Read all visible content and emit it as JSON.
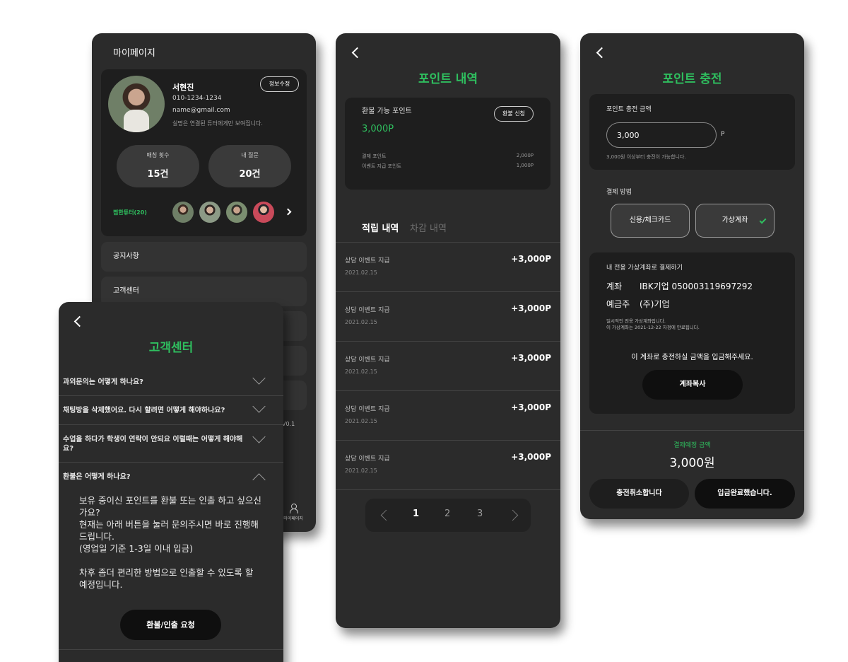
{
  "colors": {
    "accent_green": "#2fbf5f",
    "panel": "#2b2b2b",
    "card": "#1e1e1e"
  },
  "mypage": {
    "title": "마이페이지",
    "profile": {
      "name": "서현진",
      "phone": "010-1234-1234",
      "email": "name@gmail.com",
      "note": "실명은 연결된 튜터에게만 보여집니다.",
      "edit_label": "정보수정"
    },
    "stats": [
      {
        "label": "매칭 횟수",
        "value": "15건"
      },
      {
        "label": "내 질문",
        "value": "20건"
      }
    ],
    "favorites_label": "찜한튜터(20)",
    "menu": [
      "공지사항",
      "고객센터"
    ],
    "version": "V0.1",
    "nav_label": "마이페이지"
  },
  "customer_center": {
    "title": "고객센터",
    "faqs": [
      {
        "question": "과외문의는 어떻게 하나요?",
        "expanded": false
      },
      {
        "question": "채팅방을 삭제했어요. 다시 할려면 어떻게 해야하나요?",
        "expanded": false
      },
      {
        "question": "수업을 하다가 학생이 연락이 안되요 이럴때는 어떻게 해야해요?",
        "expanded": false
      },
      {
        "question": "환불은 어떻게 하나요?",
        "expanded": true
      }
    ],
    "answer": {
      "line1": "보유 중이신 포인트를 환불 또는 인출 하고 싶으신가요?",
      "line2": "현재는 아래 버튼을 눌러 문의주시면 바로 진행해드립니다.",
      "line3": "(영업일 기준 1-3일 이내 입금)",
      "line4": "차후 좀더 편리한 방법으로 인출할 수 있도록 할 예정입니다."
    },
    "refund_button": "환불/인출 요청"
  },
  "points": {
    "title": "포인트 내역",
    "refundable_label": "환불 가능 포인트",
    "refundable_value": "3,000P",
    "refund_button": "환불 신청",
    "breakdown": [
      {
        "label": "결제 포인트",
        "value": "2,000P"
      },
      {
        "label": "이벤트 지급 포인트",
        "value": "1,000P"
      }
    ],
    "tabs": [
      "적립 내역",
      "차감 내역"
    ],
    "history": [
      {
        "title": "상담 이벤트 지급",
        "date": "2021.02.15",
        "amount": "+3,000P"
      },
      {
        "title": "상담 이벤트 지급",
        "date": "2021.02.15",
        "amount": "+3,000P"
      },
      {
        "title": "상담 이벤트 지급",
        "date": "2021.02.15",
        "amount": "+3,000P"
      },
      {
        "title": "상담 이벤트 지급",
        "date": "2021.02.15",
        "amount": "+3,000P"
      },
      {
        "title": "상담 이벤트 지급",
        "date": "2021.02.15",
        "amount": "+3,000P"
      }
    ],
    "pages": [
      "1",
      "2",
      "3"
    ],
    "current_page": "1"
  },
  "charge": {
    "title": "포인트 충전",
    "amount_label": "포인트 충전 금액",
    "amount_value": "3,000",
    "amount_unit": "P",
    "amount_hint": "3,000원 이상부터 충전이 가능합니다.",
    "method_label": "결제 방법",
    "methods": [
      "신용/체크카드",
      "가상계좌"
    ],
    "selected_method": "가상계좌",
    "va_title": "내 전용 가상계좌로 결제하기",
    "account_label": "계좌",
    "account_value": "IBK기업 050003119697292",
    "holder_label": "예금주",
    "holder_value": "(주)기업",
    "va_note1": "일시적인 전용 가상계좌입니다.",
    "va_note2": "이 가상계좌는 2021-12-22 자정에 만료됩니다.",
    "deposit_prompt": "이 계좌로 충전하실 금액을 입금해주세요.",
    "copy_button": "계좌복사",
    "due_label": "결제예정 금액",
    "due_value": "3,000원",
    "cancel_button": "충전취소합니다",
    "done_button": "입금완료했습니다."
  }
}
